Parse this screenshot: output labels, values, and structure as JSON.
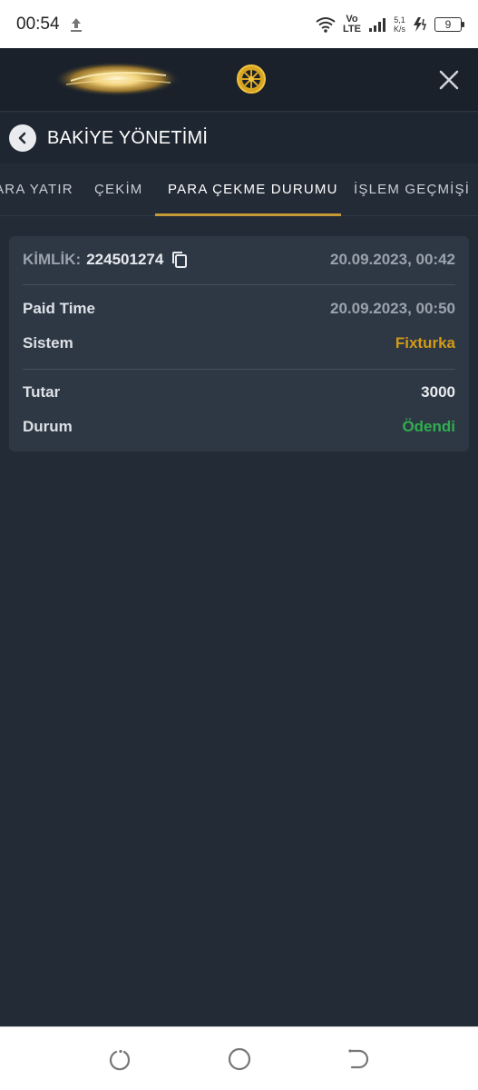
{
  "status_bar": {
    "time": "00:54",
    "network_volte": "Vo",
    "network_lte": "LTE",
    "net_speed_value": "5,1",
    "net_speed_unit": "K/s",
    "battery": "9"
  },
  "header": {
    "logo_icon": "golden-glow-logo",
    "wheel_icon": "wheel-icon",
    "close_icon": "close-icon"
  },
  "title_bar": {
    "title": "BAKİYE YÖNETİMİ",
    "back_icon": "chevron-left-icon"
  },
  "tabs": [
    {
      "label": "PARA YATIR",
      "active": false
    },
    {
      "label": "ÇEKİM",
      "active": false
    },
    {
      "label": "PARA ÇEKME DURUMU",
      "active": true
    },
    {
      "label": "İŞLEM GEÇMİŞİ",
      "active": false
    }
  ],
  "withdrawal": {
    "id_label": "KİMLİK:",
    "id_value": "224501274",
    "created_at": "20.09.2023, 00:42",
    "paid_time_label": "Paid Time",
    "paid_time_value": "20.09.2023, 00:50",
    "system_label": "Sistem",
    "system_value": "Fixturka",
    "amount_label": "Tutar",
    "amount_value": "3000",
    "status_label": "Durum",
    "status_value": "Ödendi"
  },
  "colors": {
    "accent": "#c59b3a",
    "system_value": "#d39a17",
    "status_paid": "#2fae4f",
    "background": "#232b36",
    "card": "#2e3844"
  }
}
